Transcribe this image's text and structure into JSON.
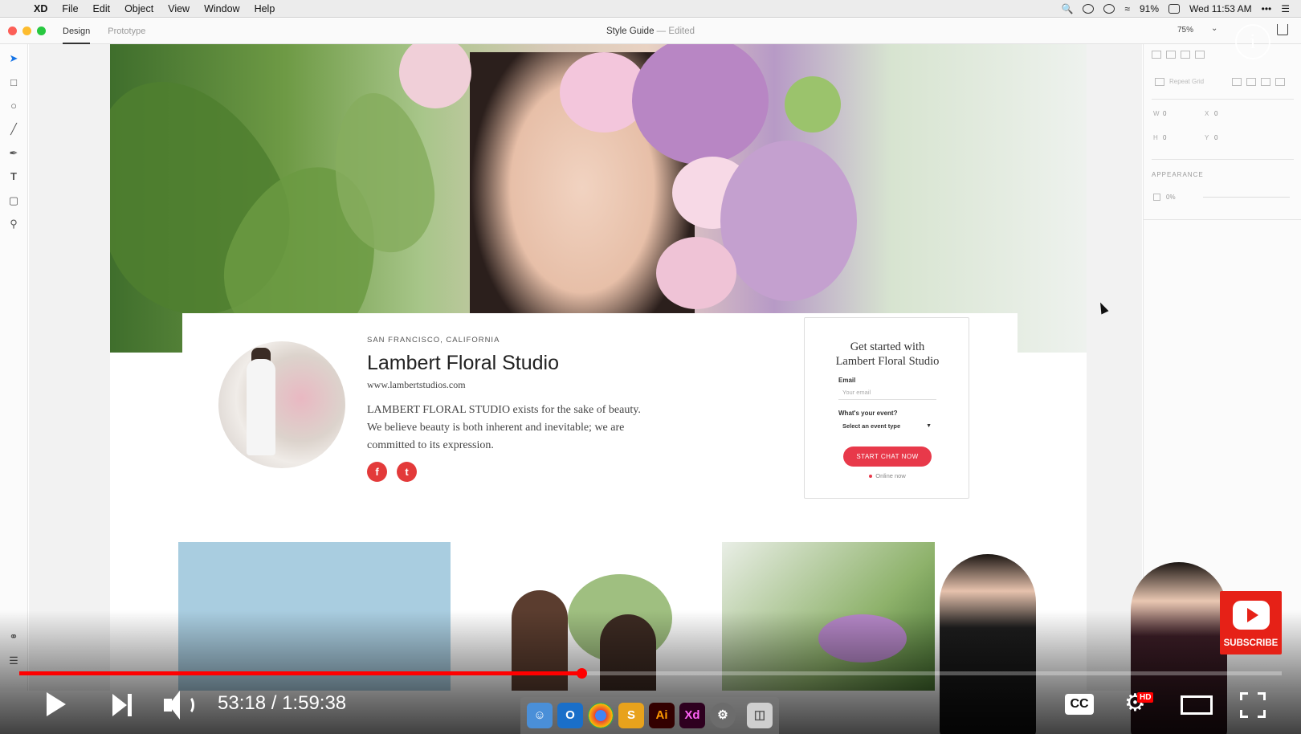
{
  "menubar": {
    "apple_glyph": "",
    "app_name": "XD",
    "items": [
      "File",
      "Edit",
      "Object",
      "View",
      "Window",
      "Help"
    ],
    "battery": "91%",
    "clock": "Wed 11:53 AM"
  },
  "window": {
    "tabs": [
      "Design",
      "Prototype"
    ],
    "active_tab": "Design",
    "doc_title": "Style Guide",
    "separator": "—",
    "doc_status": "Edited",
    "zoom": "75%"
  },
  "properties": {
    "repeat_grid": "Repeat Grid",
    "w_label": "W",
    "w_value": "0",
    "x_label": "X",
    "x_value": "0",
    "h_label": "H",
    "h_value": "0",
    "y_label": "Y",
    "y_value": "0",
    "appearance_label": "APPEARANCE",
    "opacity_value": "0%"
  },
  "artboard": {
    "location": "SAN FRANCISCO, CALIFORNIA",
    "studio_name": "Lambert Floral Studio",
    "studio_url": "www.lambertstudios.com",
    "description": "LAMBERT FLORAL STUDIO exists for the sake of beauty. We believe beauty is both inherent and inevitable; we are committed to its expression.",
    "social": [
      {
        "network": "facebook",
        "glyph": "f"
      },
      {
        "network": "twitter",
        "glyph": "t"
      }
    ],
    "form": {
      "title_line1": "Get started with",
      "title_line2": "Lambert Floral Studio",
      "email_label": "Email",
      "email_placeholder": "Your email",
      "event_label": "What's your event?",
      "event_select": "Select an event type",
      "cta": "START CHAT NOW",
      "online": "Online now"
    }
  },
  "player": {
    "current_time": "53:18",
    "time_separator": "/",
    "duration": "1:59:38",
    "progress": 0.445,
    "cc_label": "CC",
    "hd_label": "HD",
    "subscribe_label": "SUBSCRIBE"
  },
  "dock": {
    "items": [
      "Finder",
      "Outlook",
      "Chrome",
      "Sketch",
      "Ai",
      "Xd",
      "System Preferences",
      "Trash"
    ]
  },
  "colors": {
    "accent_red": "#e8394a",
    "xd_select_blue": "#1473e6",
    "youtube_red": "#ff0000"
  }
}
